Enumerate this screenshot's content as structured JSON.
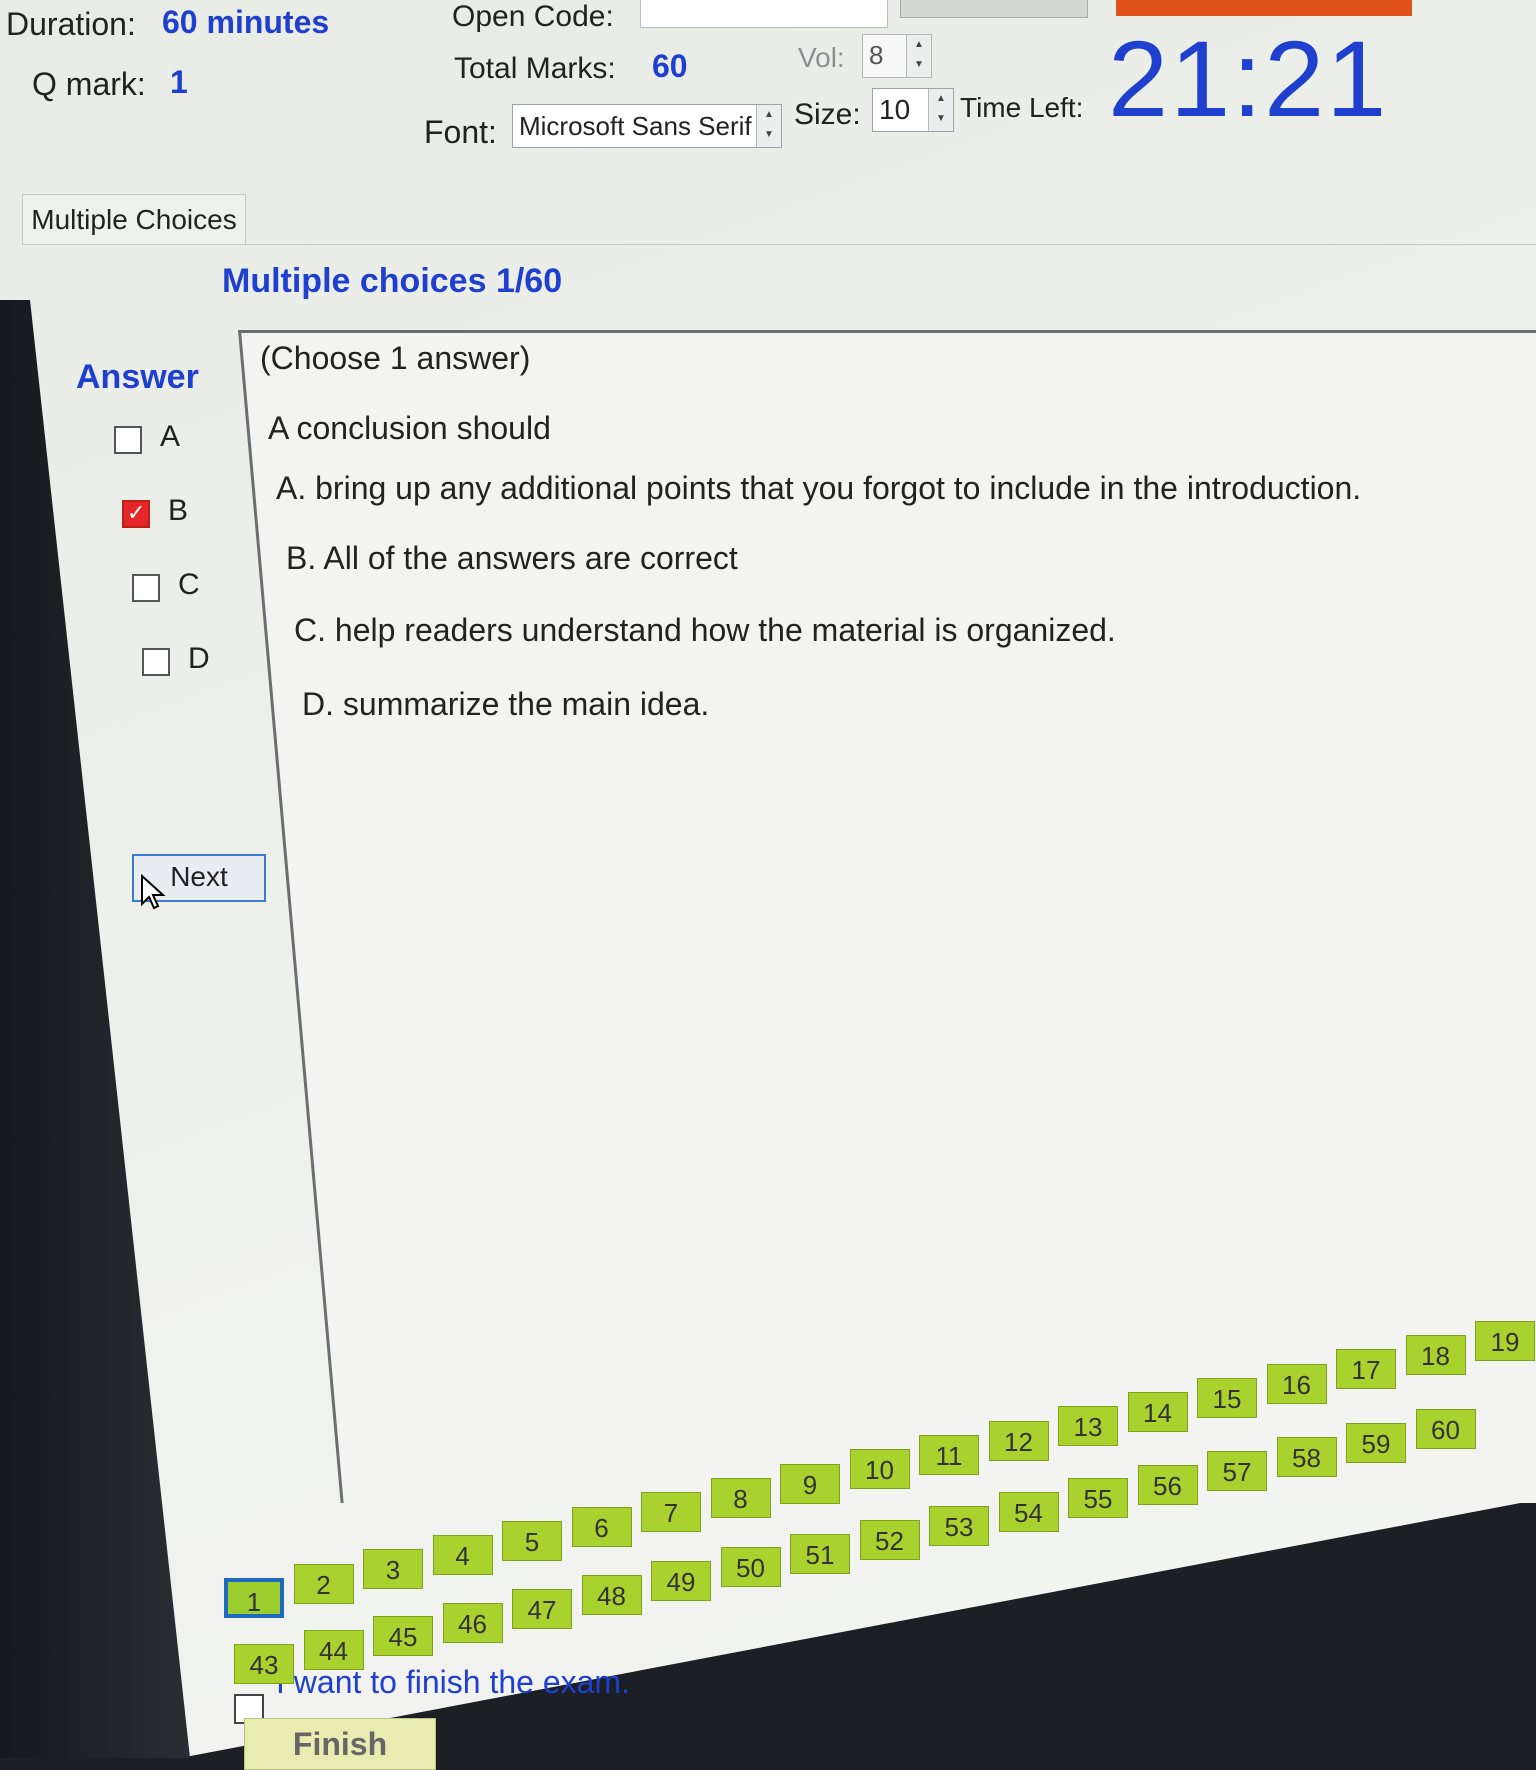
{
  "header": {
    "duration_label": "Duration:",
    "duration_value": "60 minutes",
    "qmark_label": "Q mark:",
    "qmark_value": "1",
    "open_code_label": "Open Code:",
    "open_code_value": "",
    "total_marks_label": "Total Marks:",
    "total_marks_value": "60",
    "vol_label": "Vol:",
    "vol_value": "8",
    "font_label": "Font:",
    "font_value": "Microsoft Sans Serif",
    "size_label": "Size:",
    "size_value": "10",
    "time_left_label": "Time Left:",
    "timer": "21:21"
  },
  "tab": {
    "label": "Multiple Choices"
  },
  "question": {
    "title": "Multiple choices 1/60",
    "instruction": "(Choose 1 answer)",
    "stem": "A conclusion should",
    "options": [
      {
        "letter": "A.",
        "text": "bring up any additional points that you forgot to include in the introduction."
      },
      {
        "letter": "B.",
        "text": "All of the answers are correct"
      },
      {
        "letter": "C.",
        "text": "help readers understand how the material is organized."
      },
      {
        "letter": "D.",
        "text": "summarize the main idea."
      }
    ]
  },
  "answer": {
    "heading": "Answer",
    "choices": [
      {
        "label": "A",
        "checked": false
      },
      {
        "label": "B",
        "checked": true
      },
      {
        "label": "C",
        "checked": false
      },
      {
        "label": "D",
        "checked": false
      }
    ]
  },
  "next_label": "Next",
  "navigator": {
    "row1": [
      "1",
      "2",
      "3",
      "4",
      "5",
      "6",
      "7",
      "8",
      "9",
      "10",
      "11",
      "12",
      "13",
      "14",
      "15",
      "16",
      "17",
      "18",
      "19"
    ],
    "row2": [
      "43",
      "44",
      "45",
      "46",
      "47",
      "48",
      "49",
      "50",
      "51",
      "52",
      "53",
      "54",
      "55",
      "56",
      "57",
      "58",
      "59",
      "60"
    ],
    "current": "1",
    "fill_color": "#a9d22f"
  },
  "finish": {
    "checkbox_label": "I want to finish the exam.",
    "button_label": "Finish"
  },
  "colors": {
    "accent_blue": "#1f3fcf",
    "checked_red": "#e5262b",
    "orange_bar": "#e0501d"
  }
}
